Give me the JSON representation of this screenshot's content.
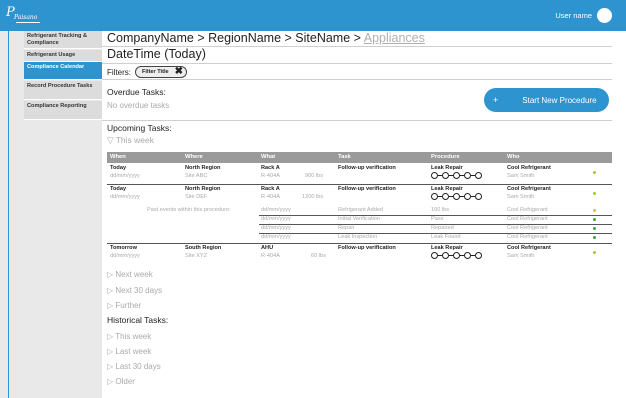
{
  "topbar": {
    "user_name": "User name",
    "logo_mark": "P",
    "logo_word": "Paisano"
  },
  "sidebar": {
    "items": [
      {
        "label": "Refrigerant Tracking & Compliance",
        "active": false
      },
      {
        "label": "Refrigerant Usage",
        "active": false
      },
      {
        "label": "Compliance Calendar",
        "active": true
      },
      {
        "label": "Record Procedure Tasks",
        "active": false
      },
      {
        "label": "Compliance Reporting",
        "active": false
      }
    ]
  },
  "header": {
    "breadcrumb_main": "CompanyName > RegionName > SiteName > ",
    "breadcrumb_current": "Appliances",
    "title": "DateTime (Today)"
  },
  "filters": {
    "label": "Filters:",
    "chip": "Filter Title"
  },
  "overdue": {
    "title": "Overdue Tasks:",
    "empty": "No overdue tasks"
  },
  "new_procedure_button": {
    "icon": "+",
    "label": "Start New Procedure"
  },
  "upcoming": {
    "title": "Upcoming Tasks:",
    "this_week": "▽ This week"
  },
  "table": {
    "headers": [
      "When",
      "Where",
      "What",
      "Task",
      "Procedure",
      "Who"
    ],
    "rows": [
      {
        "when": "Today",
        "date": "dd/mm/yyyy",
        "where": "North Region",
        "site": "Site ABC",
        "what": "Rack A",
        "refrigerant": "R-404A",
        "amount": "900 lbs",
        "task": "Follow-up verification",
        "procedure": "Leak Repair",
        "who": "Cool Refrigerant",
        "person": "Sam Smith",
        "dot_color": "#9acd32"
      },
      {
        "when": "Today",
        "date": "dd/mm/yyyy",
        "where": "North Region",
        "site": "Site DEF",
        "what": "Rack A",
        "refrigerant": "R-404A",
        "amount": "1200 lbs",
        "task": "Follow-up verification",
        "procedure": "Leak Repair",
        "who": "Cool Refrigerant",
        "person": "Sam Smith",
        "dot_color": "#9acd32"
      },
      {
        "when": "Tomorrow",
        "date": "dd/mm/yyyy",
        "where": "South Region",
        "site": "Site XYZ",
        "what": "AHU",
        "refrigerant": "R-404A",
        "amount": "60 lbs",
        "task": "Follow-up verification",
        "procedure": "Leak Repair",
        "who": "Cool Refrigerant",
        "person": "Sam Smith",
        "dot_color": "#9acd32"
      }
    ],
    "past_label": "Past events within this procedure:",
    "past_events": [
      {
        "date": "dd/mm/yyyy",
        "event": "Refrigerant Added",
        "result": "100 lbs",
        "who": "Cool Refrigerant",
        "dot_color": "#e0c020"
      },
      {
        "date": "dd/mm/yyyy",
        "event": "Initial Verification",
        "result": "Pass",
        "who": "Cool Refrigerant",
        "dot_color": "#3aa745"
      },
      {
        "date": "dd/mm/yyyy",
        "event": "Repair",
        "result": "Repaired",
        "who": "Cool Refrigerant",
        "dot_color": "#3aa745"
      },
      {
        "date": "dd/mm/yyyy",
        "event": "Leak Inspection",
        "result": "Leak Found",
        "who": "Cool Refrigerant",
        "dot_color": "#3aa745"
      }
    ]
  },
  "upcoming_more": [
    "▷ Next week",
    "▷ Next 30 days",
    "▷ Further"
  ],
  "historical": {
    "title": "Historical Tasks:",
    "links": [
      "▷ This week",
      "▷ Last week",
      "▷ Last 30 days",
      "▷ Older"
    ]
  }
}
